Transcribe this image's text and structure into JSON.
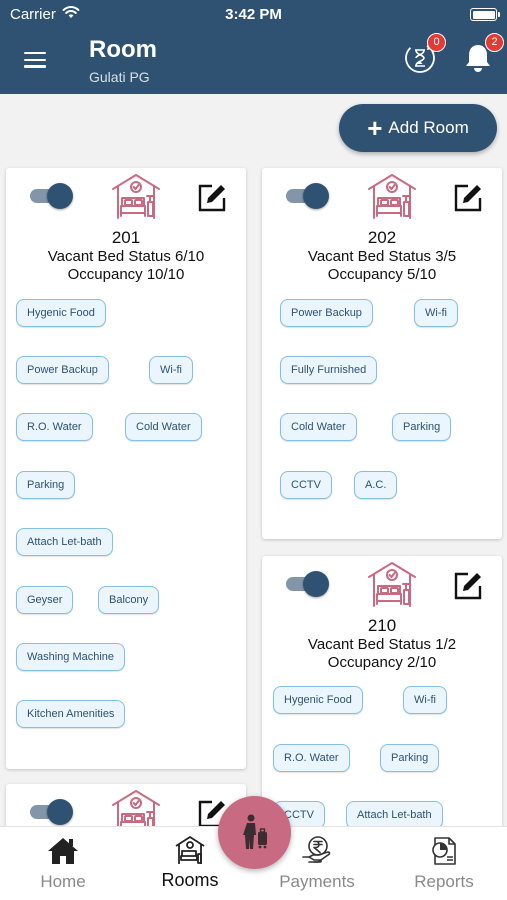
{
  "status_bar": {
    "carrier": "Carrier",
    "time": "3:42 PM"
  },
  "header": {
    "title": "Room",
    "subtitle": "Gulati PG",
    "hourglass_badge": "0",
    "bell_badge": "2"
  },
  "add_room": {
    "label": "Add Room"
  },
  "rooms": [
    {
      "number": "201",
      "vacant": "Vacant Bed Status 6/10",
      "occupancy": "Occupancy 10/10",
      "enabled": true,
      "amenities": [
        "Hygenic Food",
        "Power Backup",
        "Wi-fi",
        "R.O. Water",
        "Cold Water",
        "Parking",
        "Attach Let-bath",
        "Geyser",
        "Balcony",
        "Washing Machine",
        "Kitchen Amenities"
      ]
    },
    {
      "number": "202",
      "vacant": "Vacant Bed Status 3/5",
      "occupancy": "Occupancy 5/10",
      "enabled": true,
      "amenities": [
        "Power Backup",
        "Wi-fi",
        "Fully Furnished",
        "Cold Water",
        "Parking",
        "CCTV",
        "A.C."
      ]
    },
    {
      "number": "210",
      "vacant": "Vacant Bed Status 1/2",
      "occupancy": "Occupancy 2/10",
      "enabled": true,
      "amenities": [
        "Hygenic Food",
        "Wi-fi",
        "R.O. Water",
        "Parking",
        "CCTV",
        "Attach Let-bath"
      ]
    },
    {
      "enabled": true
    }
  ],
  "bottom_nav": {
    "home": "Home",
    "rooms": "Rooms",
    "payments": "Payments",
    "reports": "Reports"
  },
  "colors": {
    "primary": "#2f5273",
    "accent": "#c86b82",
    "chip_border": "#84bfe8",
    "badge": "#e53935"
  },
  "icons": {
    "menu": "menu-icon",
    "hourglass": "hourglass-icon",
    "bell": "bell-icon",
    "bed": "bed-icon",
    "edit": "edit-icon",
    "home": "home-icon",
    "rooms": "rooms-icon",
    "payments": "rupee-icon",
    "reports": "report-icon",
    "fab": "person-luggage-icon"
  }
}
